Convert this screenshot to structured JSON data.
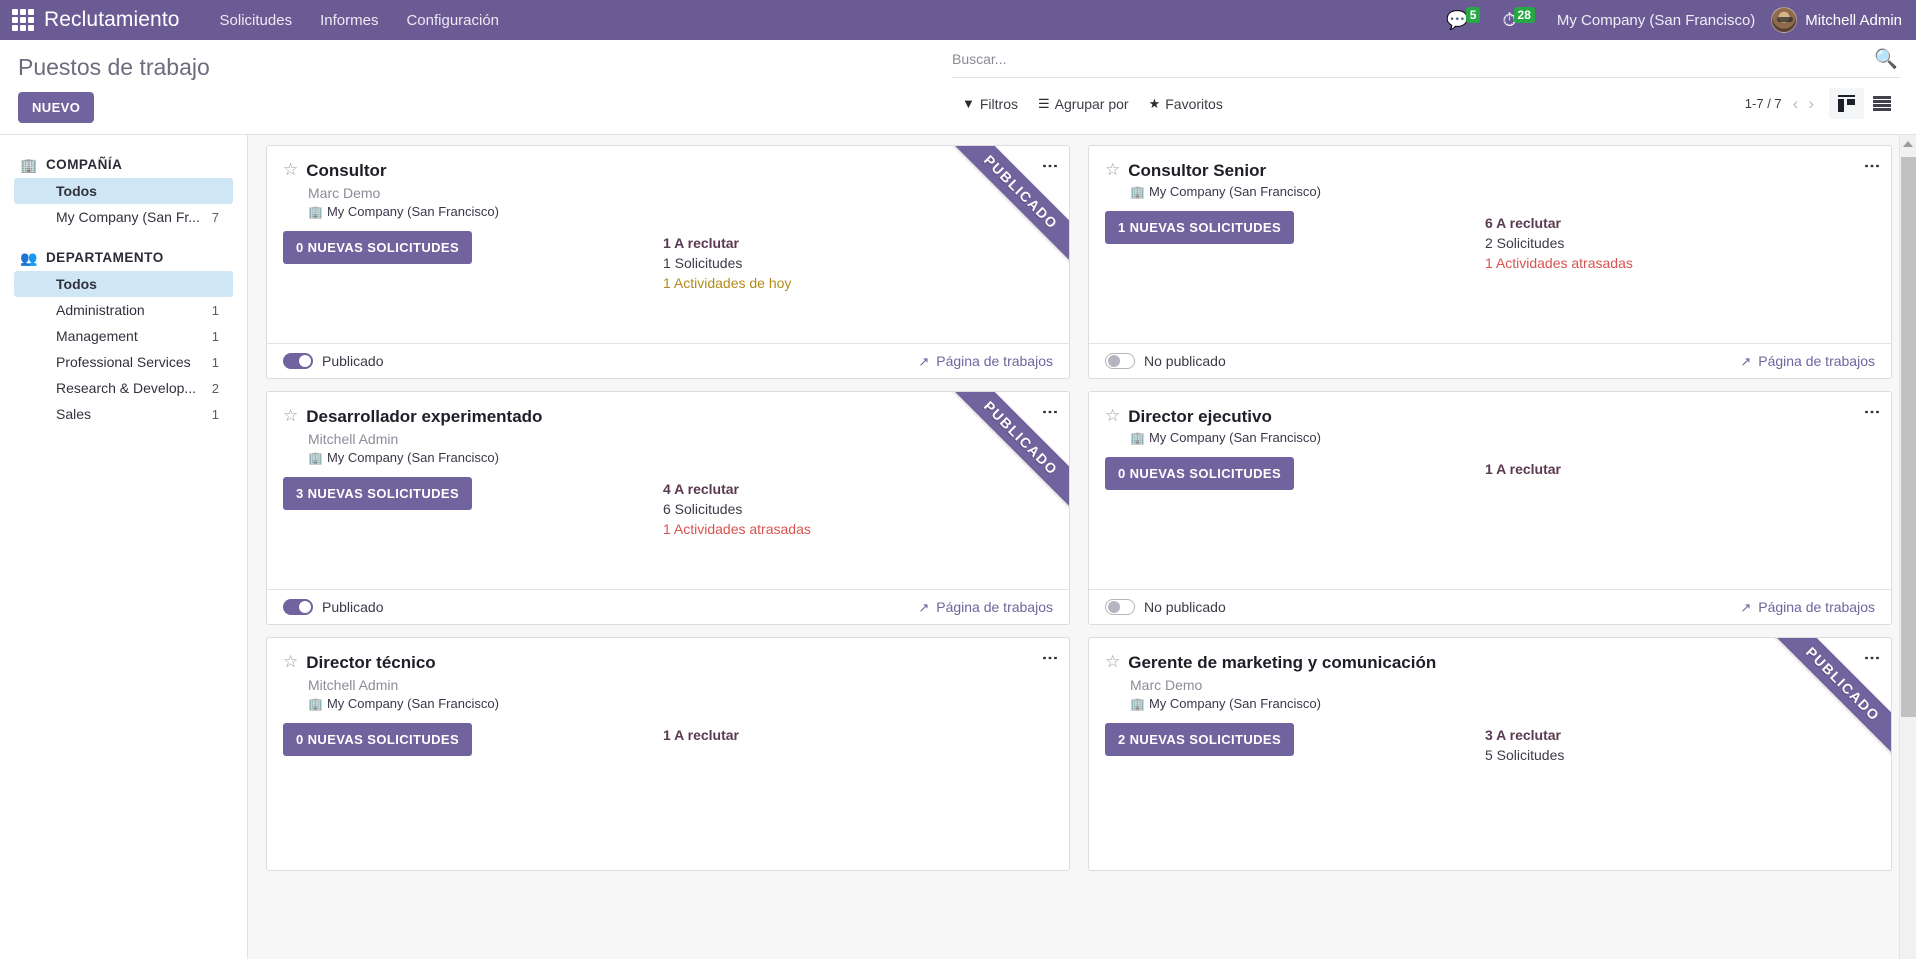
{
  "navbar": {
    "brand": "Reclutamiento",
    "apps_icon": "apps-grid-icon",
    "menu": [
      {
        "label": "Solicitudes"
      },
      {
        "label": "Informes"
      },
      {
        "label": "Configuración"
      }
    ],
    "messages_count": "5",
    "activities_count": "28",
    "company": "My Company (San Francisco)",
    "user": "Mitchell Admin"
  },
  "control_panel": {
    "title": "Puestos de trabajo",
    "new_button": "NUEVO",
    "search_placeholder": "Buscar...",
    "filters": "Filtros",
    "group_by": "Agrupar por",
    "favorites": "Favoritos",
    "pager": "1-7 / 7"
  },
  "sidebar": {
    "sections": [
      {
        "title": "COMPAÑÍA",
        "icon": "building-icon",
        "items": [
          {
            "label": "Todos",
            "count": "",
            "selected": true
          },
          {
            "label": "My Company (San Fr...",
            "count": "7",
            "selected": false
          }
        ]
      },
      {
        "title": "DEPARTAMENTO",
        "icon": "users-icon",
        "items": [
          {
            "label": "Todos",
            "count": "",
            "selected": true
          },
          {
            "label": "Administration",
            "count": "1",
            "selected": false
          },
          {
            "label": "Management",
            "count": "1",
            "selected": false
          },
          {
            "label": "Professional Services",
            "count": "1",
            "selected": false
          },
          {
            "label": "Research & Develop...",
            "count": "2",
            "selected": false
          },
          {
            "label": "Sales",
            "count": "1",
            "selected": false
          }
        ]
      }
    ]
  },
  "labels": {
    "published": "Publicado",
    "unpublished": "No publicado",
    "jobs_page": "Página de trabajos",
    "ribbon": "PUBLICADO"
  },
  "cards": [
    {
      "title": "Consultor",
      "manager": "Marc Demo",
      "company": "My Company (San Francisco)",
      "apps_button": "0 NUEVAS SOLICITUDES",
      "recruit": "1 A reclutar",
      "applications": "1 Solicitudes",
      "today_activities": "1 Actividades de hoy",
      "late_activities": "",
      "published": true,
      "publish_label": "Publicado",
      "ribbon": "PUBLICADO"
    },
    {
      "title": "Consultor Senior",
      "manager": "",
      "company": "My Company (San Francisco)",
      "apps_button": "1 NUEVAS SOLICITUDES",
      "recruit": "6 A reclutar",
      "applications": "2 Solicitudes",
      "today_activities": "",
      "late_activities": "1 Actividades atrasadas",
      "published": false,
      "publish_label": "No publicado",
      "ribbon": ""
    },
    {
      "title": "Desarrollador experimentado",
      "manager": "Mitchell Admin",
      "company": "My Company (San Francisco)",
      "apps_button": "3 NUEVAS SOLICITUDES",
      "recruit": "4 A reclutar",
      "applications": "6 Solicitudes",
      "today_activities": "",
      "late_activities": "1 Actividades atrasadas",
      "published": true,
      "publish_label": "Publicado",
      "ribbon": "PUBLICADO"
    },
    {
      "title": "Director ejecutivo",
      "manager": "",
      "company": "My Company (San Francisco)",
      "apps_button": "0 NUEVAS SOLICITUDES",
      "recruit": "1 A reclutar",
      "applications": "",
      "today_activities": "",
      "late_activities": "",
      "published": false,
      "publish_label": "No publicado",
      "ribbon": ""
    },
    {
      "title": "Director técnico",
      "manager": "Mitchell Admin",
      "company": "My Company (San Francisco)",
      "apps_button": "0 NUEVAS SOLICITUDES",
      "recruit": "1 A reclutar",
      "applications": "",
      "today_activities": "",
      "late_activities": "",
      "published": false,
      "publish_label": "",
      "ribbon": ""
    },
    {
      "title": "Gerente de marketing y comunicación",
      "manager": "Marc Demo",
      "company": "My Company (San Francisco)",
      "apps_button": "2 NUEVAS SOLICITUDES",
      "recruit": "3 A reclutar",
      "applications": "5 Solicitudes",
      "today_activities": "",
      "late_activities": "",
      "published": false,
      "publish_label": "",
      "ribbon": "PUBLICADO"
    }
  ],
  "colors": {
    "brand_purple": "#6b5b95",
    "button_purple": "#71639e",
    "selected_blue": "#cfe7f5",
    "badge_green": "#28a745",
    "late_red": "#d9534f",
    "today_yellow": "#b28c18"
  }
}
